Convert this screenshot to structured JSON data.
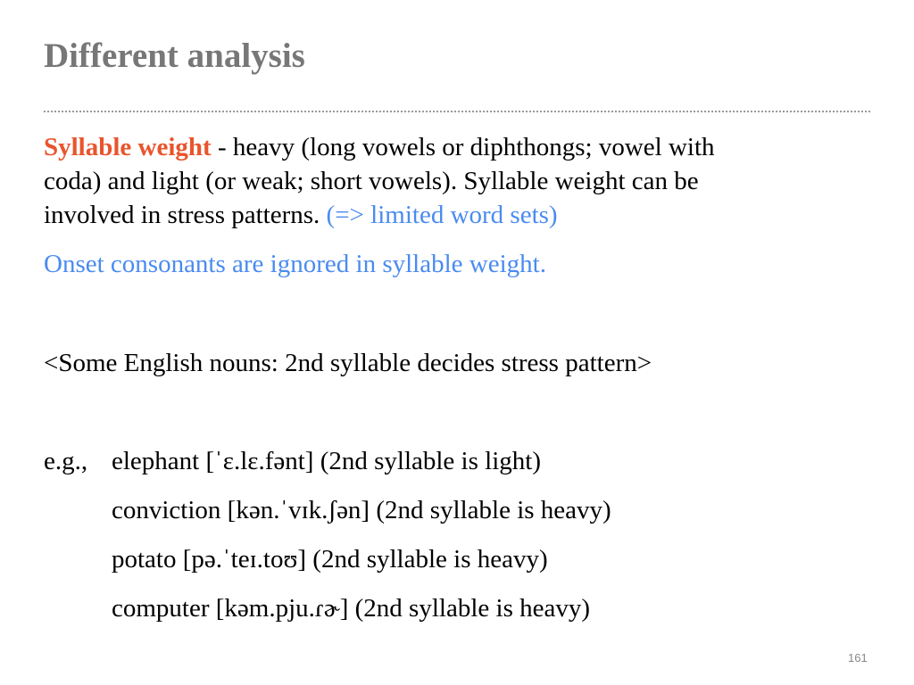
{
  "slide": {
    "title": "Different analysis",
    "para1": {
      "term": "Syllable weight",
      "line1_rest": " - heavy (long vowels or diphthongs; vowel with",
      "line2": "coda) and light (or weak; short vowels). Syllable weight can be",
      "line3": "involved in stress patterns. ",
      "line3_note": "(=> limited word sets)"
    },
    "para2": "Onset consonants are ignored in syllable weight.",
    "heading": "<Some English nouns: 2nd syllable decides stress pattern>",
    "examples": {
      "prefix": "e.g.,",
      "items": [
        "elephant [ˈɛ.lɛ.fənt] (2nd syllable is light)",
        "conviction [kən.ˈvɪk.ʃən] (2nd syllable is heavy)",
        "potato [pə.ˈteɪ.toʊ] (2nd syllable is heavy)",
        "computer [kəm.pju.ɾɚ] (2nd syllable is heavy)"
      ]
    },
    "page_number": "161",
    "colors": {
      "title": "#777777",
      "accent_red": "#e8552d",
      "accent_blue": "#4a8bf0"
    }
  }
}
